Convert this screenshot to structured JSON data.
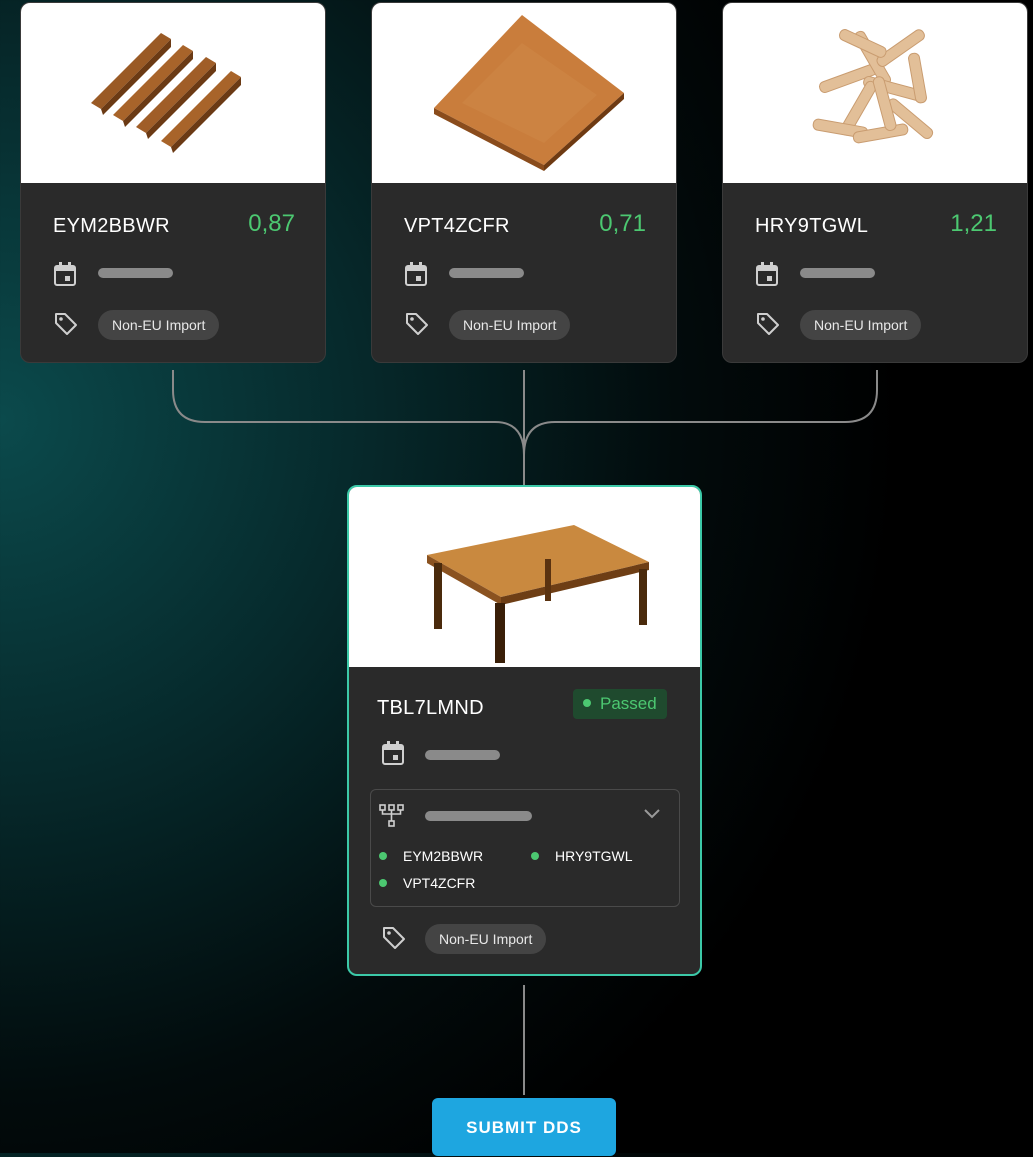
{
  "components": [
    {
      "code": "EYM2BBWR",
      "score": "0,87",
      "tag": "Non-EU Import",
      "image": "wooden-beams"
    },
    {
      "code": "VPT4ZCFR",
      "score": "0,71",
      "tag": "Non-EU Import",
      "image": "wooden-tabletop"
    },
    {
      "code": "HRY9TGWL",
      "score": "1,21",
      "tag": "Non-EU Import",
      "image": "wooden-dowels"
    }
  ],
  "product": {
    "code": "TBL7LMND",
    "status": "Passed",
    "image": "wooden-table",
    "sources": [
      "EYM2BBWR",
      "HRY9TGWL",
      "VPT4ZCFR"
    ],
    "tag": "Non-EU Import"
  },
  "actions": {
    "submit_label": "SUBMIT DDS"
  },
  "colors": {
    "accent_green": "#4cc871",
    "submit_blue": "#1ea6e0",
    "card_bg": "#2a2a2a",
    "product_border": "#3cc9a8"
  },
  "icons": [
    "calendar-icon",
    "tag-icon",
    "hierarchy-icon",
    "chevron-down-icon",
    "status-dot-icon"
  ]
}
